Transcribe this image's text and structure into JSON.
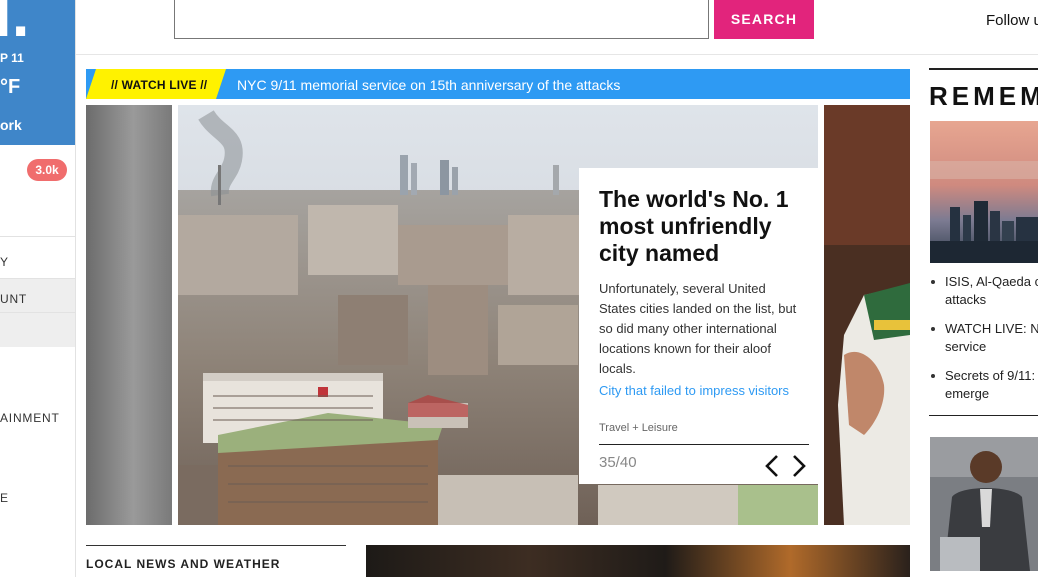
{
  "sidebar": {
    "logo_mark": "l.",
    "date": "P 11",
    "temp": "°F",
    "city": "ork",
    "count_badge": "3.0k",
    "nav": [
      "Y",
      "UNT",
      "",
      "AINMENT",
      "E"
    ]
  },
  "header": {
    "search_value": "",
    "search_button": "SEARCH",
    "follow": "Follow u"
  },
  "live_banner": {
    "tag": "// WATCH LIVE //",
    "headline": "NYC 9/11 memorial service on 15th anniversary of the attacks",
    "tag_color": "#fff200",
    "banner_color": "#2e9af3"
  },
  "carousel": {
    "title": "The world's No. 1 most unfriendly city named",
    "description": "Unfortunately, several United States cities landed on the list, but so did many other international locations known for their aloof locals.",
    "link": "City that failed to impress visitors",
    "source": "Travel + Leisure",
    "pager": "35/40",
    "prev_icon": "chevron-left-icon",
    "next_icon": "chevron-right-icon"
  },
  "local_news": {
    "heading": "LOCAL NEWS AND WEATHER"
  },
  "rail": {
    "heading": "REMEMB",
    "items": [
      {
        "line1": "ISIS, Al-Qaeda c",
        "line2": "attacks"
      },
      {
        "line1": "WATCH LIVE: N",
        "line2": "service"
      },
      {
        "line1": "Secrets of 9/11:",
        "line2": "emerge"
      }
    ]
  },
  "colors": {
    "accent_pink": "#e2247c",
    "brand_blue": "#3f86c9",
    "link_blue": "#2e9af3",
    "badge_red": "#f06d6d"
  }
}
